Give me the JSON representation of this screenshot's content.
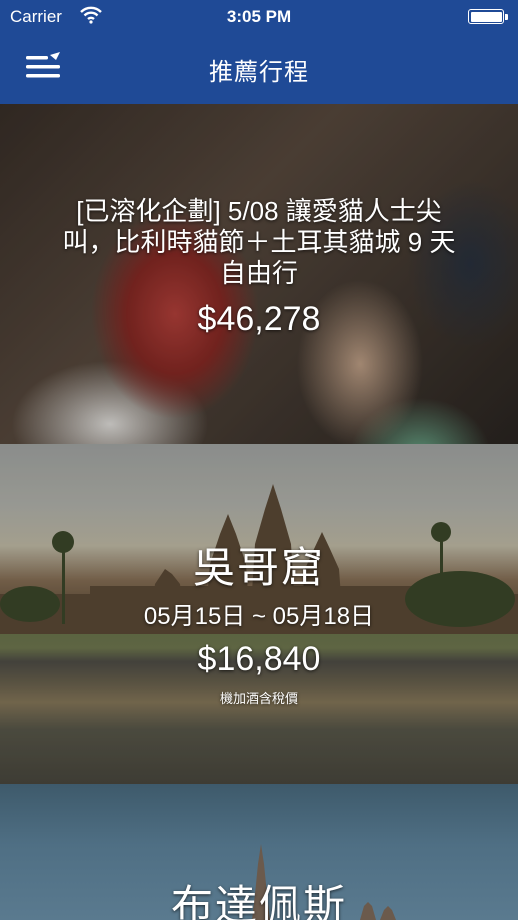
{
  "status_bar": {
    "carrier": "Carrier",
    "time": "3:05 PM",
    "battery_level": 1.0
  },
  "nav": {
    "title": "推薦行程",
    "menu_icon": "menu-icon"
  },
  "colors": {
    "nav_background": "#1f4a96",
    "text": "#ffffff"
  },
  "cards": [
    {
      "title": "[已溶化企劃] 5/08 讓愛貓人士尖叫，比利時貓節＋土耳其貓城 9 天自由行",
      "price": "$46,278"
    },
    {
      "title": "吳哥窟",
      "dates": "05月15日 ~ 05月18日",
      "price": "$16,840",
      "note": "機加酒含稅價"
    },
    {
      "title": "布達佩斯"
    }
  ]
}
